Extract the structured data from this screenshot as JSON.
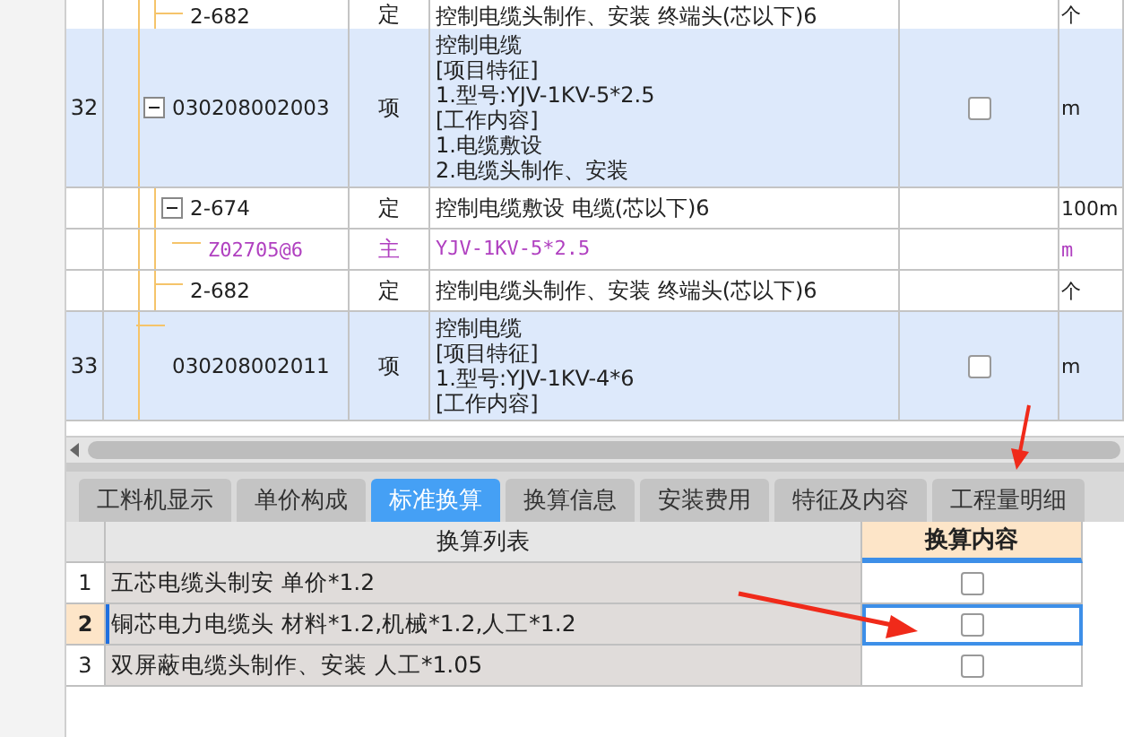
{
  "top_table": {
    "continued_children": [
      {
        "kind": "quota",
        "code": "2-682",
        "type": "定",
        "lines": [
          "控制电缆头制作、安装 终端头(芯以下)6"
        ],
        "unit": "个"
      }
    ],
    "items": [
      {
        "kind": "item",
        "number": "32",
        "code": "030208002003",
        "type": "项",
        "lines": [
          "控制电缆",
          "[项目特征]",
          "1.型号:YJV-1KV-5*2.5",
          "[工作内容]",
          "1.电缆敷设",
          "2.电缆头制作、安装"
        ],
        "checked": false,
        "unit": "m",
        "children": [
          {
            "kind": "quota",
            "code": "2-674",
            "type": "定",
            "lines": [
              "控制电缆敷设 电缆(芯以下)6"
            ],
            "unit": "100m",
            "children": [
              {
                "kind": "material",
                "code": "Z02705@6",
                "type": "主",
                "lines": [
                  "YJV-1KV-5*2.5"
                ],
                "unit": "m"
              }
            ]
          },
          {
            "kind": "quota",
            "code": "2-682",
            "type": "定",
            "lines": [
              "控制电缆头制作、安装 终端头(芯以下)6"
            ],
            "unit": "个"
          }
        ]
      },
      {
        "kind": "item",
        "number": "33",
        "code": "030208002011",
        "type": "项",
        "lines": [
          "控制电缆",
          "[项目特征]",
          "1.型号:YJV-1KV-4*6",
          "[工作内容]"
        ],
        "checked": false,
        "unit": "m"
      }
    ]
  },
  "tabs": [
    {
      "label": "工料机显示",
      "selected": false
    },
    {
      "label": "单价构成",
      "selected": false
    },
    {
      "label": "标准换算",
      "selected": true
    },
    {
      "label": "换算信息",
      "selected": false
    },
    {
      "label": "安装费用",
      "selected": false
    },
    {
      "label": "特征及内容",
      "selected": false
    },
    {
      "label": "工程量明细",
      "selected": false
    }
  ],
  "conversion_table": {
    "columns": [
      "换算列表",
      "换算内容"
    ],
    "rows": [
      {
        "number": "1",
        "text": "五芯电缆头制安 单价*1.2",
        "checked": false,
        "selected": false
      },
      {
        "number": "2",
        "text": "铜芯电力电缆头 材料*1.2,机械*1.2,人工*1.2",
        "checked": false,
        "selected": true
      },
      {
        "number": "3",
        "text": "双屏蔽电缆头制作、安装 人工*1.05",
        "checked": false,
        "selected": false
      }
    ]
  }
}
